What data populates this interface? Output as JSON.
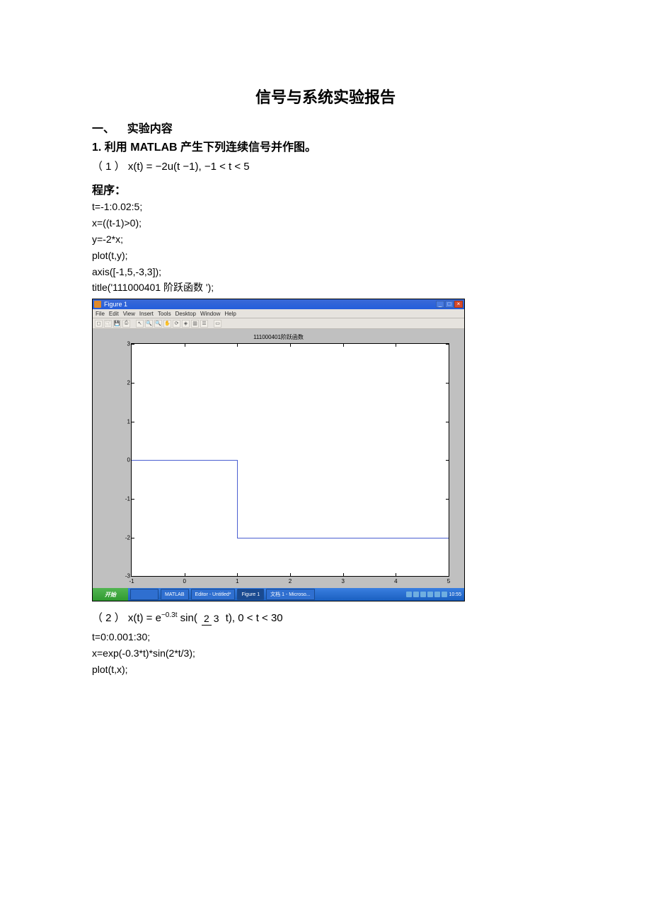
{
  "doc": {
    "title": "信号与系统实验报告",
    "section1_num": "一、",
    "section1_label": "实验内容",
    "task1": "1.   利用  MATLAB   产生下列连续信号并作图。",
    "eq1_prefix": "（ 1 ）",
    "program_label": "程序：",
    "code1": {
      "l1": "t=-1:0.02:5;",
      "l2": "x=((t-1)>0);",
      "l3": "y=-2*x;",
      "l4": "plot(t,y);",
      "l5": "axis([-1,5,-3,3]);",
      "l6": "title('111000401   阶跃函数   ');"
    },
    "eq2_prefix": "（ 2 ）",
    "code2": {
      "l1": "  t=0:0.001:30;",
      "l2": "x=exp(-0.3*t)*sin(2*t/3);",
      "l3": "plot(t,x);"
    }
  },
  "figure": {
    "window_title": "Figure 1",
    "menus": [
      "File",
      "Edit",
      "View",
      "Insert",
      "Tools",
      "Desktop",
      "Window",
      "Help"
    ],
    "plot_title": "111000401阶跃函数",
    "yticks": [
      "3",
      "2",
      "1",
      "0",
      "-1",
      "-2",
      "-3"
    ],
    "xticks": [
      "-1",
      "0",
      "1",
      "2",
      "3",
      "4",
      "5"
    ]
  },
  "taskbar": {
    "start": "开始",
    "items": [
      "",
      "MATLAB",
      "Editor - Untitled*",
      "Figure 1",
      "文档 1 - Microso..."
    ],
    "clock": "10:55"
  },
  "chart_data": {
    "type": "line",
    "title": "111000401阶跃函数",
    "xlabel": "",
    "ylabel": "",
    "xlim": [
      -1,
      5
    ],
    "ylim": [
      -3,
      3
    ],
    "series": [
      {
        "name": "y = -2*u(t-1)",
        "x": [
          -1,
          1,
          1,
          5
        ],
        "y": [
          0,
          0,
          -2,
          -2
        ]
      }
    ]
  }
}
